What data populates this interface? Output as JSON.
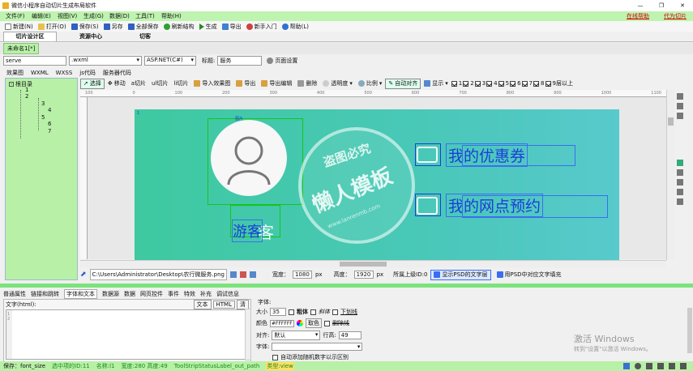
{
  "window": {
    "title": "微信小程序自动切片生成布局软件",
    "min": "—",
    "max": "❐",
    "close": "✕"
  },
  "menu": [
    "文件(F)",
    "编辑(E)",
    "视图(V)",
    "生成(G)",
    "数据(D)",
    "工具(T)",
    "帮助(H)"
  ],
  "menu_links": [
    "在线帮助",
    "代为切片"
  ],
  "toolbar": [
    "新建(N)",
    "打开(O)",
    "保存(S)",
    "另存",
    "全部保存",
    "刷新结构",
    "生成",
    "导出",
    "新手入门",
    "帮助(L)"
  ],
  "main_tabs": [
    "切片设计区",
    "资源中心",
    "切客"
  ],
  "doc_tab": "未命名1[*]",
  "path_row": {
    "left_input": "serve",
    "ext_select": ".wxml",
    "lang_select": "ASP.NET(C#)",
    "label": "标题:",
    "title_value": "服务",
    "page_settings": "页面设置"
  },
  "view_tabs": [
    "效果图",
    "WXML",
    "WXSS",
    "js代码",
    "服务器代码"
  ],
  "tree": {
    "root": "根目录",
    "nodes": [
      "1",
      "2",
      "3",
      "4",
      "5",
      "6",
      "7"
    ]
  },
  "design_tools": [
    "选择",
    "移动",
    "a切片",
    "ul切片",
    "li切片",
    "导入效果图",
    "导出",
    "导出编辑",
    "删除",
    "透明度",
    "比例",
    "自动对齐",
    "显示"
  ],
  "layer_checks": [
    "1",
    "2",
    "3",
    "4",
    "5",
    "6",
    "7",
    "8",
    "9层以上"
  ],
  "ruler_labels": [
    "100",
    "0",
    "100",
    "200",
    "300",
    "400",
    "500",
    "600",
    "700",
    "800",
    "900",
    "1000",
    "1100"
  ],
  "canvas": {
    "coupon_text": "我的优惠券",
    "appointment_text": "我的网点预约",
    "guest_text": "游客",
    "guest_text_echo": "客",
    "watermark_top": "盗图必究",
    "watermark_main": "懒人模板",
    "watermark_url": "www.lanrenmb.com",
    "slice_tag": "图片",
    "slice_tag_index": "1"
  },
  "status_row": {
    "path": "C:\\Users\\Administrator\\Desktop\\农行微服务.png",
    "width_label": "宽度：",
    "width_value": "1080",
    "px1": "px",
    "height_label": "高度：",
    "height_value": "1920",
    "px2": "px",
    "parent_label": "所属上级ID:0",
    "show_psd": "显示PSD的文字层",
    "use_psd": "用PSD中对应文字填充"
  },
  "props_tabs": [
    "普通属性",
    "链接和跳转",
    "字体和文本",
    "数据源",
    "数据",
    "网页控件",
    "事件",
    "特效",
    "补充",
    "调试信息"
  ],
  "text_panel": {
    "label": "文字(html):",
    "b1": "文本",
    "b2": "HTML",
    "b3": "清",
    "line1": "1",
    "line2": "2"
  },
  "font_panel": {
    "title": "字体:",
    "size_label": "大小",
    "size_value": "35",
    "bold": "粗体",
    "italic": "斜体",
    "underline": "下划线",
    "color_label": "颜色",
    "color_value": "#FFFFFF",
    "pick": "取色",
    "strike": "删除线",
    "align_label": "对齐:",
    "align_value": "默认",
    "line_label": "行高:",
    "line_value": "49",
    "font_label": "字体:",
    "random_label": "自动添加随机数字以示区别"
  },
  "statusbar": {
    "left": "保存：font_size",
    "sel": "选中项的ID:11",
    "name": "名称:l1",
    "size": "宽度:280 高度:49",
    "tool": "ToolStripStatusLabel_out_path",
    "type": "类型:view"
  },
  "activate": {
    "title": "激活 Windows",
    "sub": "转到\"设置\"以激活 Windows。"
  },
  "colors": {
    "accent_green": "#22aa22",
    "canvas_teal": "#3cc6a8",
    "status_green": "#b8f0a8",
    "link_red": "#d00000"
  }
}
